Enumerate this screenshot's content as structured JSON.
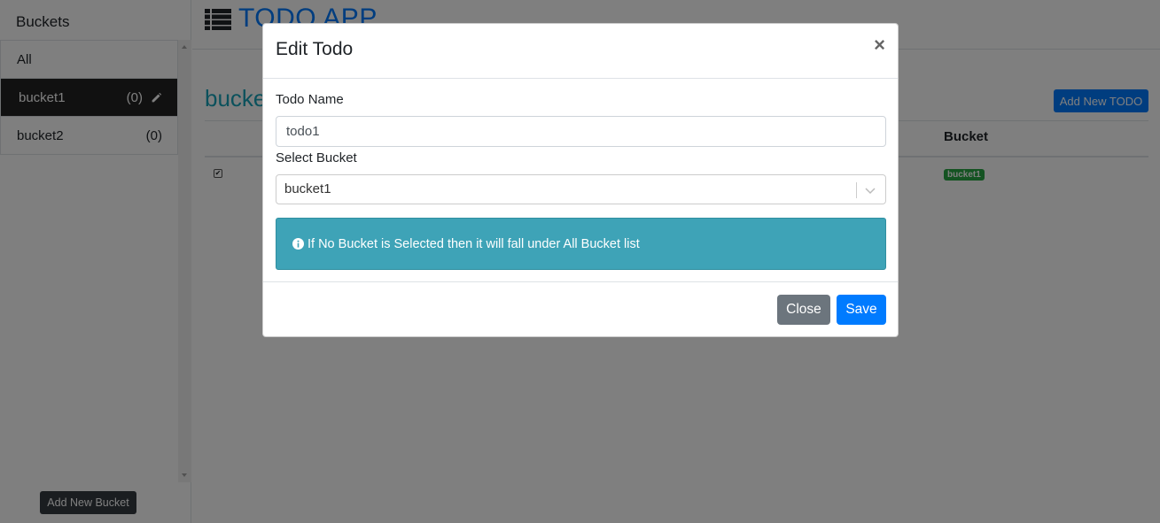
{
  "sidebar": {
    "title": "Buckets",
    "items": [
      {
        "name": "All",
        "count": ""
      },
      {
        "name": "bucket1",
        "count": "(0)"
      },
      {
        "name": "bucket2",
        "count": "(0)"
      }
    ],
    "add_button": "Add New Bucket"
  },
  "header": {
    "title": "TODO APP"
  },
  "main": {
    "heading": "bucket1",
    "add_todo_button": "Add New TODO",
    "columns": {
      "bucket": "Bucket"
    },
    "rows": [
      {
        "bucket_badge": "bucket1"
      }
    ]
  },
  "modal": {
    "title": "Edit Todo",
    "close_symbol": "×",
    "todo_name_label": "Todo Name",
    "todo_name_value": "todo1",
    "select_bucket_label": "Select Bucket",
    "select_bucket_value": "bucket1",
    "info_text": "If No Bucket is Selected then it will fall under All Bucket list",
    "close_button": "Close",
    "save_button": "Save"
  },
  "icons": [
    "list-icon",
    "pencil-icon",
    "info-icon",
    "chevron-down-icon"
  ],
  "colors": {
    "primary": "#007bff",
    "info": "#3ea3b7",
    "secondary": "#6c757d",
    "active_bucket": "#222222",
    "badge": "#28a745"
  }
}
